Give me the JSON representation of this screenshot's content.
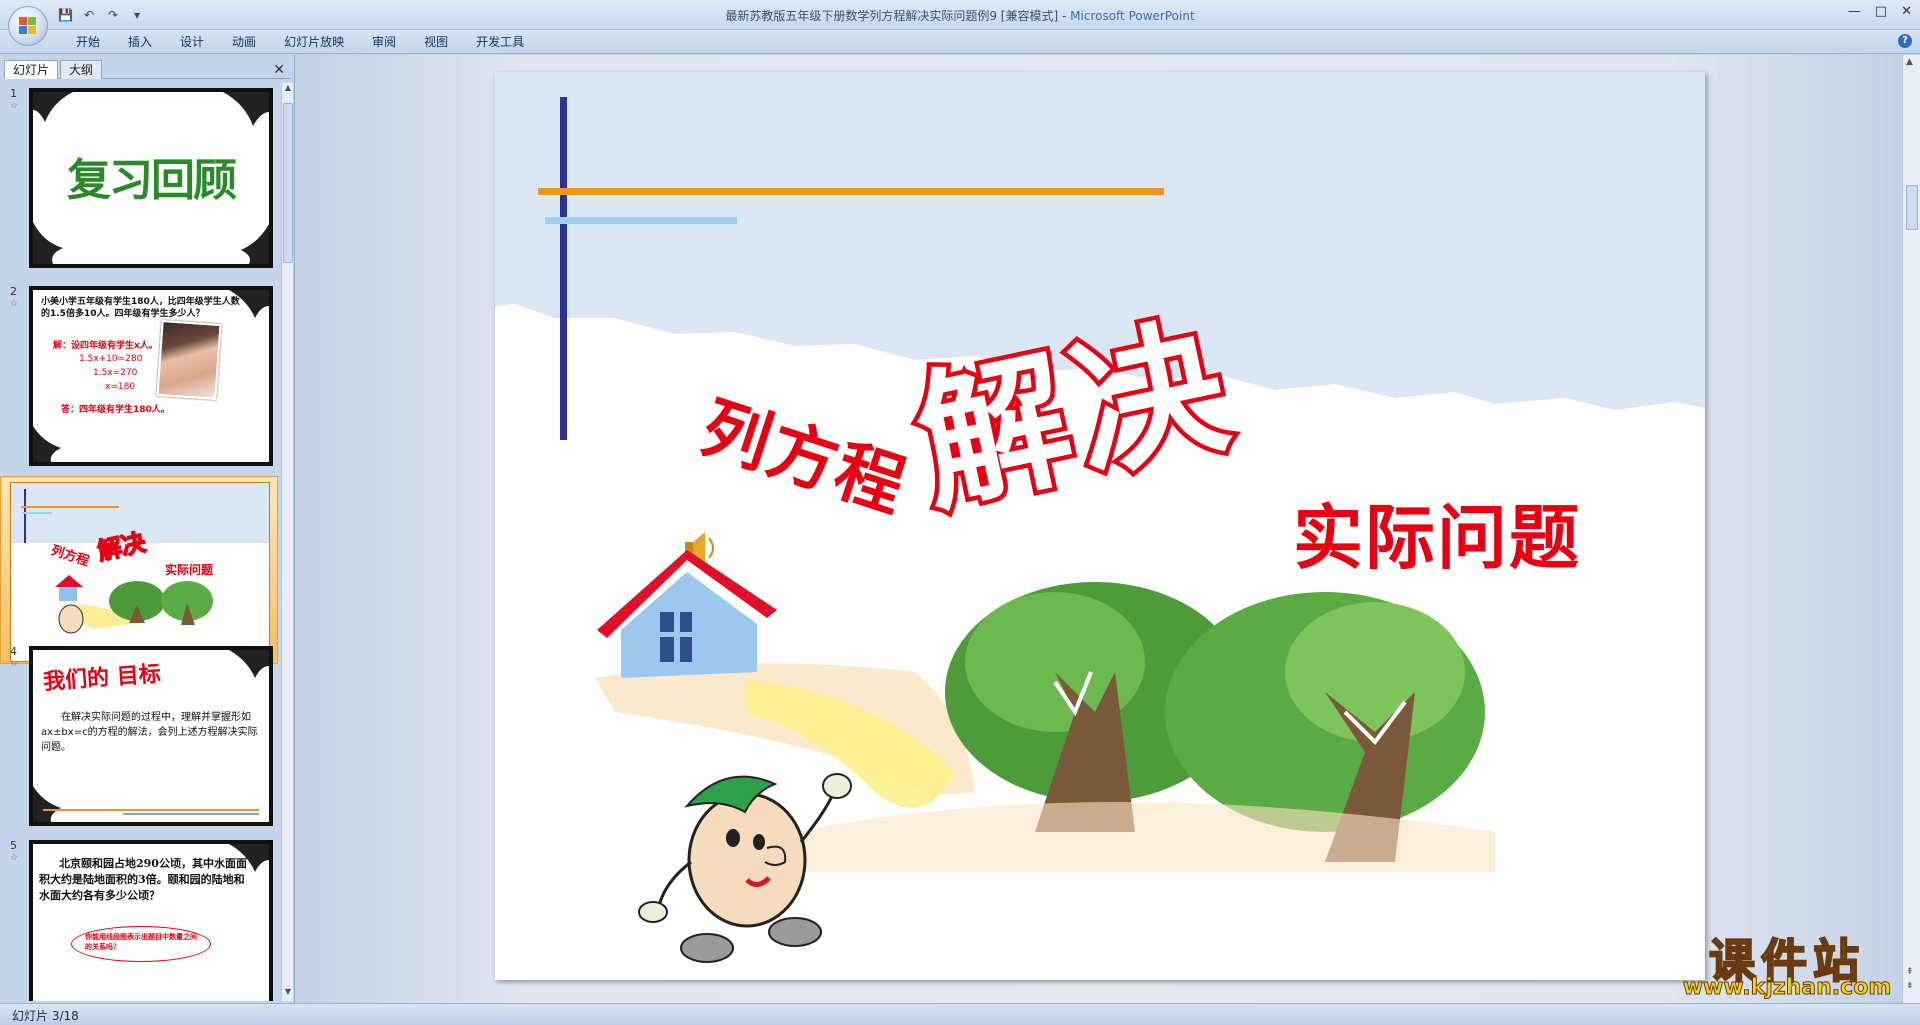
{
  "window": {
    "title": "最新苏教版五年级下册数学列方程解决实际问题例9 [兼容模式]",
    "app_name": "Microsoft PowerPoint",
    "controls": [
      "—",
      "□",
      "✕"
    ]
  },
  "ribbon": {
    "tabs": [
      "开始",
      "插入",
      "设计",
      "动画",
      "幻灯片放映",
      "审阅",
      "视图",
      "开发工具"
    ]
  },
  "left_panel": {
    "tabs": [
      "幻灯片",
      "大纲"
    ],
    "close": "✕"
  },
  "thumbnails": [
    {
      "num": "1",
      "title": "复习回顾"
    },
    {
      "num": "2",
      "text": "小美小学五年级有学生180人，比四年级学生人数的1.5倍多10人。四年级有学生多少人？",
      "solve": "解：设四年级有学生x人。",
      "eq1": "1.5x+10=280",
      "eq2": "1.5x=270",
      "eq3": "x=180",
      "answer": "答：四年级有学生180人。"
    },
    {
      "num": "3",
      "t1": "列方程",
      "t2": "解决",
      "t3": "实际问题"
    },
    {
      "num": "4",
      "title": "我们的 目标",
      "text": "在解决实际问题的过程中，理解并掌握形如ax±bx=c的方程的解法，会列上述方程解决实际问题。"
    },
    {
      "num": "5",
      "text": "北京颐和园占地290公顷，其中水面面积大约是陆地面积的3倍。颐和园的陆地和水面大约各有多少公顷？",
      "bubble": "你能用线段图表示出题目中数量之间的关系吗？"
    }
  ],
  "slide": {
    "line1": "列方程",
    "line2": "解决",
    "line3": "实际问题"
  },
  "status": {
    "text": "幻灯片 3/18"
  },
  "watermark": {
    "cn": "课件站",
    "url": "www.kjzhan.com"
  },
  "colors": {
    "title_red": "#e60012",
    "sky_blue": "#dbe7f4",
    "orange_line": "#f7941d",
    "navy_line": "#2e3192",
    "light_blue_line": "#9fd0f0",
    "selection": "#f7bf5f"
  }
}
